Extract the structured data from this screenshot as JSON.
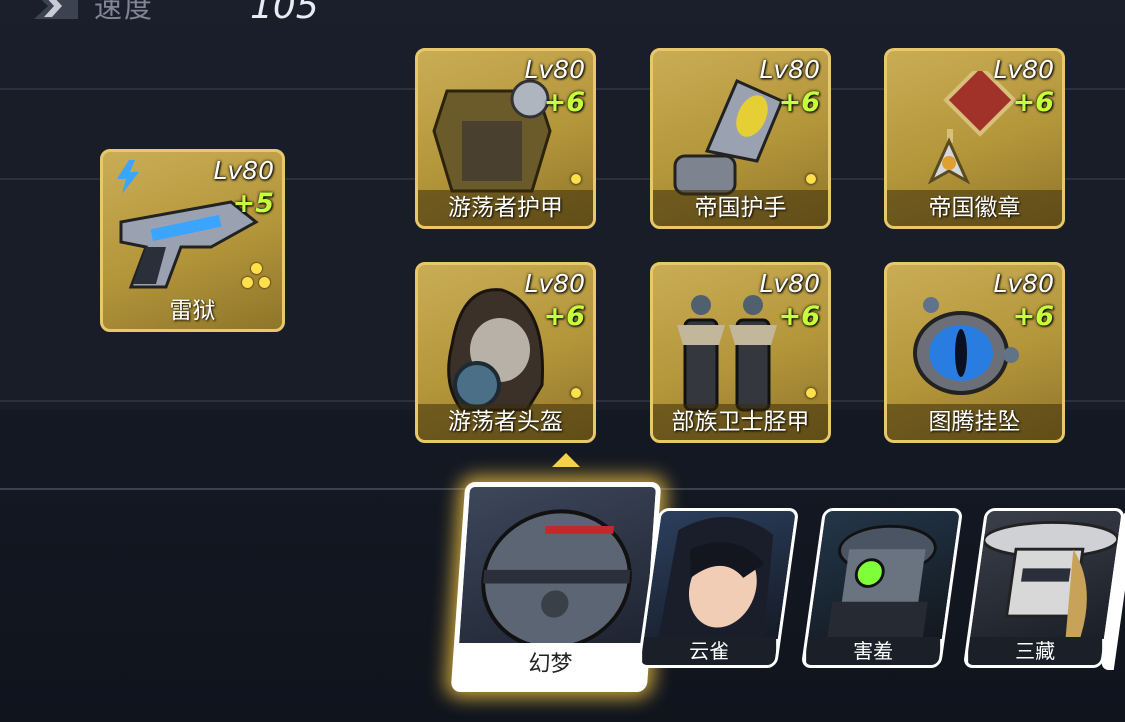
{
  "stat": {
    "label": "速度",
    "value": "105",
    "icon": "chevron-icon"
  },
  "weapon": {
    "name": "雷狱",
    "level": "Lv80",
    "plus": "+5",
    "element": "lightning-icon"
  },
  "equipment": [
    {
      "name": "游荡者护甲",
      "level": "Lv80",
      "plus": "+6",
      "icon": "armor-icon"
    },
    {
      "name": "帝国护手",
      "level": "Lv80",
      "plus": "+6",
      "icon": "gauntlet-icon"
    },
    {
      "name": "帝国徽章",
      "level": "Lv80",
      "plus": "+6",
      "icon": "medal-icon"
    },
    {
      "name": "游荡者头盔",
      "level": "Lv80",
      "plus": "+6",
      "icon": "helmet-icon"
    },
    {
      "name": "部族卫士胫甲",
      "level": "Lv80",
      "plus": "+6",
      "icon": "greaves-icon"
    },
    {
      "name": "图腾挂坠",
      "level": "Lv80",
      "plus": "+6",
      "icon": "pendant-icon"
    }
  ],
  "heroes": [
    {
      "name": "幻梦",
      "selected": true
    },
    {
      "name": "云雀",
      "selected": false
    },
    {
      "name": "害羞",
      "selected": false
    },
    {
      "name": "三藏",
      "selected": false
    }
  ],
  "colors": {
    "gold": "#c9ad55",
    "plus_green": "#c6ff3c",
    "highlight": "#f5d24a"
  }
}
